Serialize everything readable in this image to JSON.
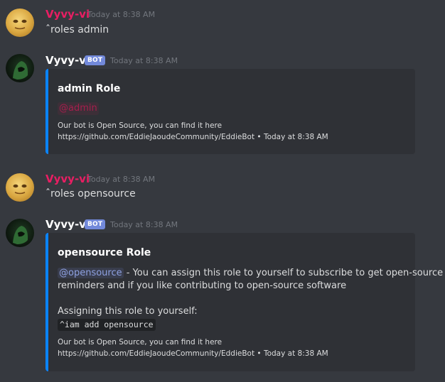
{
  "messages": [
    {
      "author": "Vyvy-vi",
      "timestamp": "Today at 8:38 AM",
      "text": "ˆroles admin"
    },
    {
      "author": "Vyvy-vi",
      "bot_tag": "BOT",
      "timestamp": "Today at 8:38 AM",
      "embed": {
        "title": "admin Role",
        "mention": "@admin",
        "footer_line1": "Our bot is Open Source, you can find it here",
        "footer_line2": "https://github.com/EddieJaoudeCommunity/EddieBot • Today at 8:38 AM"
      }
    },
    {
      "author": "Vyvy-vi",
      "timestamp": "Today at 8:38 AM",
      "text": "ˆroles opensource"
    },
    {
      "author": "Vyvy-vi",
      "bot_tag": "BOT",
      "timestamp": "Today at 8:38 AM",
      "embed": {
        "title": "opensource Role",
        "mention": "@opensource",
        "desc_line1": " - You can assign this role to yourself to subscribe to get open-source",
        "desc_line2": "reminders and if you like contributing to open-source software",
        "assign_label": "Assigning this role to yourself:",
        "code": "^iam add opensource",
        "footer_line1": "Our bot is Open Source, you can find it here",
        "footer_line2": "https://github.com/EddieJaoudeCommunity/EddieBot • Today at 8:38 AM"
      }
    }
  ],
  "colors": {
    "background": "#36393f",
    "embed_background": "#2f3136",
    "embed_accent": "#0a84ff",
    "user_name": "#e91e63",
    "bot_tag": "#7289da"
  },
  "icons": {
    "user_avatar": "yellow-face-avatar-icon",
    "bot_avatar": "green-hooded-avatar-icon"
  }
}
